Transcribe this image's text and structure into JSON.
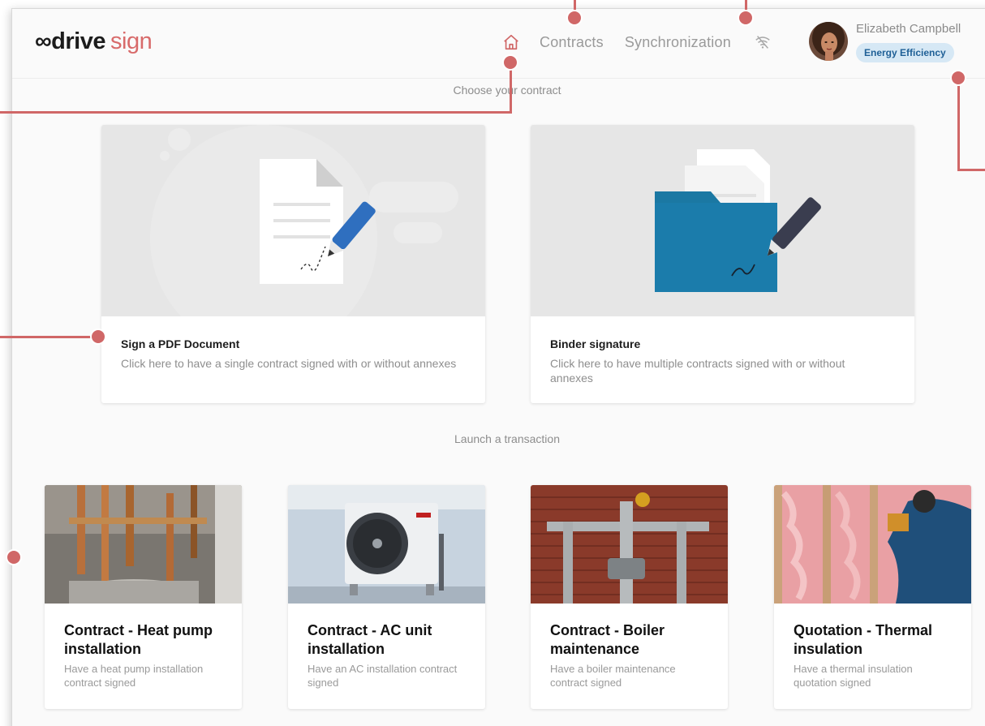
{
  "brand": {
    "logo_part1": "∞drive",
    "logo_part2": "sign"
  },
  "nav": {
    "home_icon": "home-icon",
    "links": [
      "Contracts",
      "Synchronization"
    ],
    "offline_icon": "wifi-off-icon"
  },
  "user": {
    "name": "Elizabeth Campbell",
    "badge": "Energy Efficiency"
  },
  "contracts_section": {
    "title": "Choose your contract",
    "cards": [
      {
        "title": "Sign a PDF Document",
        "description": "Click here to have a single contract signed with or without annexes"
      },
      {
        "title": "Binder signature",
        "description": "Click here to have multiple contracts signed with or without annexes"
      }
    ]
  },
  "transactions_section": {
    "title": "Launch a transaction",
    "cards": [
      {
        "title": "Contract - Heat pump installation",
        "description": "Have a heat pump installation contract signed"
      },
      {
        "title": "Contract - AC unit installation",
        "description": "Have an AC installation contract signed"
      },
      {
        "title": "Contract - Boiler maintenance",
        "description": "Have a boiler maintenance contract signed"
      },
      {
        "title": "Quotation - Thermal insulation",
        "description": "Have a thermal insulation quotation signed"
      }
    ]
  },
  "colors": {
    "accent": "#d86b6b",
    "callout": "#d06767",
    "badge_bg": "#d6e8f5",
    "badge_text": "#1e5f96",
    "folder": "#1b78a3",
    "pen": "#2f6fbf"
  }
}
